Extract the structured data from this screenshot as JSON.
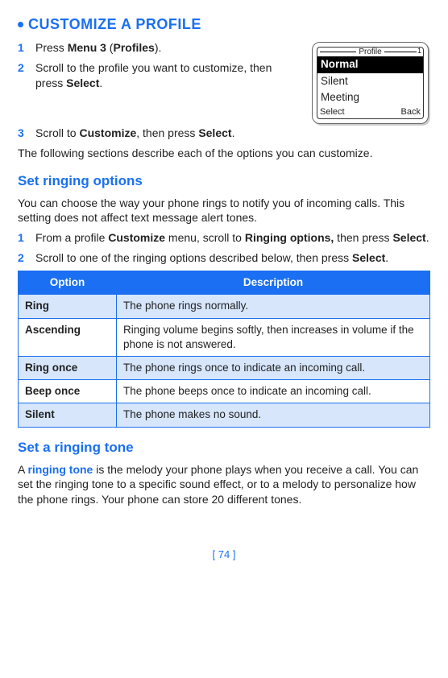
{
  "heading_main": "CUSTOMIZE A PROFILE",
  "steps_top": [
    {
      "num": "1",
      "pre": "Press ",
      "b1": "Menu 3",
      "mid": " (",
      "b2": "Profiles",
      "post": ")."
    },
    {
      "num": "2",
      "pre": "Scroll to the profile you want to customize, then press ",
      "b1": "Select",
      "mid": ".",
      "b2": "",
      "post": ""
    },
    {
      "num": "3",
      "pre": "Scroll to ",
      "b1": "Customize",
      "mid": ", then press ",
      "b2": "Select",
      "post": "."
    }
  ],
  "para_after_steps": "The following sections describe each of the options you can customize.",
  "h2_ringopts": "Set ringing options",
  "para_ringopts": "You can choose the way your phone rings to notify you of incoming calls. This setting does not affect text message alert tones.",
  "steps_ring": [
    {
      "num": "1",
      "pre": "From a profile ",
      "b1": "Customize",
      "mid": " menu, scroll to ",
      "b2": "Ringing options,",
      "post": " then press ",
      "b3": "Select",
      "tail": "."
    },
    {
      "num": "2",
      "pre": "Scroll to one of the ringing options described below, then press ",
      "b1": "Select",
      "mid": ".",
      "b2": "",
      "post": "",
      "b3": "",
      "tail": ""
    }
  ],
  "table": {
    "head_option": "Option",
    "head_desc": "Description",
    "rows": [
      {
        "opt": "Ring",
        "desc": "The phone rings normally."
      },
      {
        "opt": "Ascending",
        "desc": "Ringing volume begins softly, then increases in volume if the phone is not answered."
      },
      {
        "opt": "Ring once",
        "desc": "The phone rings once to indicate an incoming call."
      },
      {
        "opt": "Beep once",
        "desc": "The phone beeps once to indicate an incoming call."
      },
      {
        "opt": "Silent",
        "desc": "The phone makes no sound."
      }
    ]
  },
  "h2_tone": "Set a ringing tone",
  "para_tone_lead": "A ",
  "para_tone_kw": "ringing tone",
  "para_tone_rest": " is the melody your phone plays when you receive a call. You can set the ringing tone to a specific sound effect, or to a melody to personalize how the phone rings. Your phone can store 20 different tones.",
  "phone": {
    "title": "Profile",
    "corner": "1",
    "items": [
      "Normal",
      "Silent",
      "Meeting"
    ],
    "soft_left": "Select",
    "soft_right": "Back"
  },
  "pagenum": "[ 74 ]"
}
